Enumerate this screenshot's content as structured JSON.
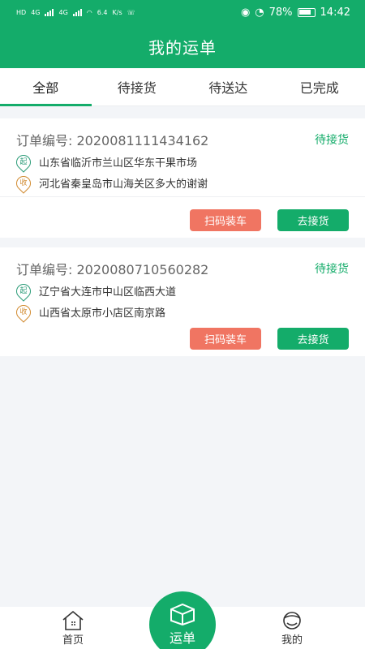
{
  "status_bar": {
    "left_labels": [
      "HD",
      "4G",
      "4G",
      "6.4",
      "K/s"
    ],
    "battery": "78%",
    "time": "14:42"
  },
  "header": {
    "title": "我的运单"
  },
  "tabs": [
    {
      "label": "全部",
      "active": true
    },
    {
      "label": "待接货",
      "active": false
    },
    {
      "label": "待送达",
      "active": false
    },
    {
      "label": "已完成",
      "active": false
    }
  ],
  "orders": [
    {
      "order_no": "订单编号:  2020081111434162",
      "status": "待接货",
      "pickup_icon_label": "起",
      "pickup_address": "山东省临沂市兰山区华东干果市场",
      "drop_icon_label": "收",
      "drop_address": "河北省秦皇岛市山海关区多大的谢谢",
      "scan_button": "扫码装车",
      "pick_button": "去接货"
    },
    {
      "order_no": "订单编号:  2020080710560282",
      "status": "待接货",
      "pickup_icon_label": "起",
      "pickup_address": "辽宁省大连市中山区临西大道",
      "drop_icon_label": "收",
      "drop_address": "山西省太原市小店区南京路",
      "scan_button": "扫码装车",
      "pick_button": "去接货"
    }
  ],
  "bottom_nav": {
    "home": "首页",
    "center": "运单",
    "mine": "我的"
  },
  "colors": {
    "brand": "#14ac6a",
    "scan_button": "#f07562"
  }
}
